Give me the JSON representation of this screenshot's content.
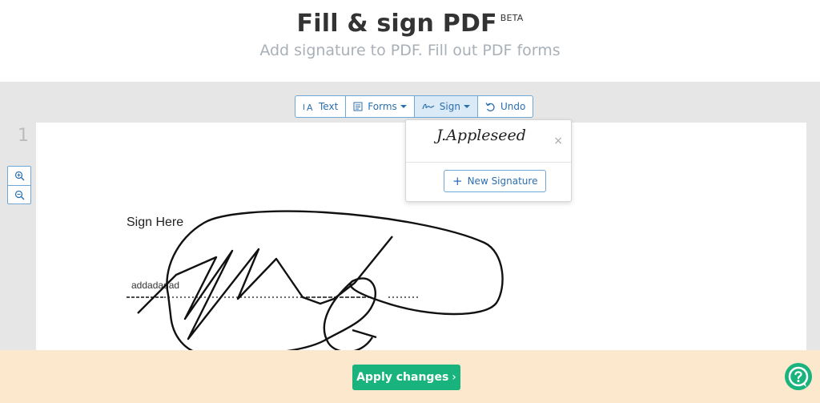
{
  "header": {
    "title": "Fill & sign PDF",
    "badge": "BETA",
    "subtitle": "Add signature to PDF. Fill out PDF forms"
  },
  "toolbar": {
    "text_label": "Text",
    "forms_label": "Forms",
    "sign_label": "Sign",
    "undo_label": "Undo"
  },
  "page": {
    "number": "1",
    "sign_here_label": "Sign Here",
    "field_text": "addadadad"
  },
  "sign_dropdown": {
    "saved_signature": "J.Appleseed",
    "close_symbol": "×",
    "new_signature_label": "New Signature"
  },
  "footer": {
    "apply_label": "Apply changes"
  },
  "colors": {
    "accent": "#2b6fb0",
    "apply_green": "#19b37e",
    "footer_bg": "#fce8cd",
    "workspace_bg": "#e6e6e6"
  }
}
